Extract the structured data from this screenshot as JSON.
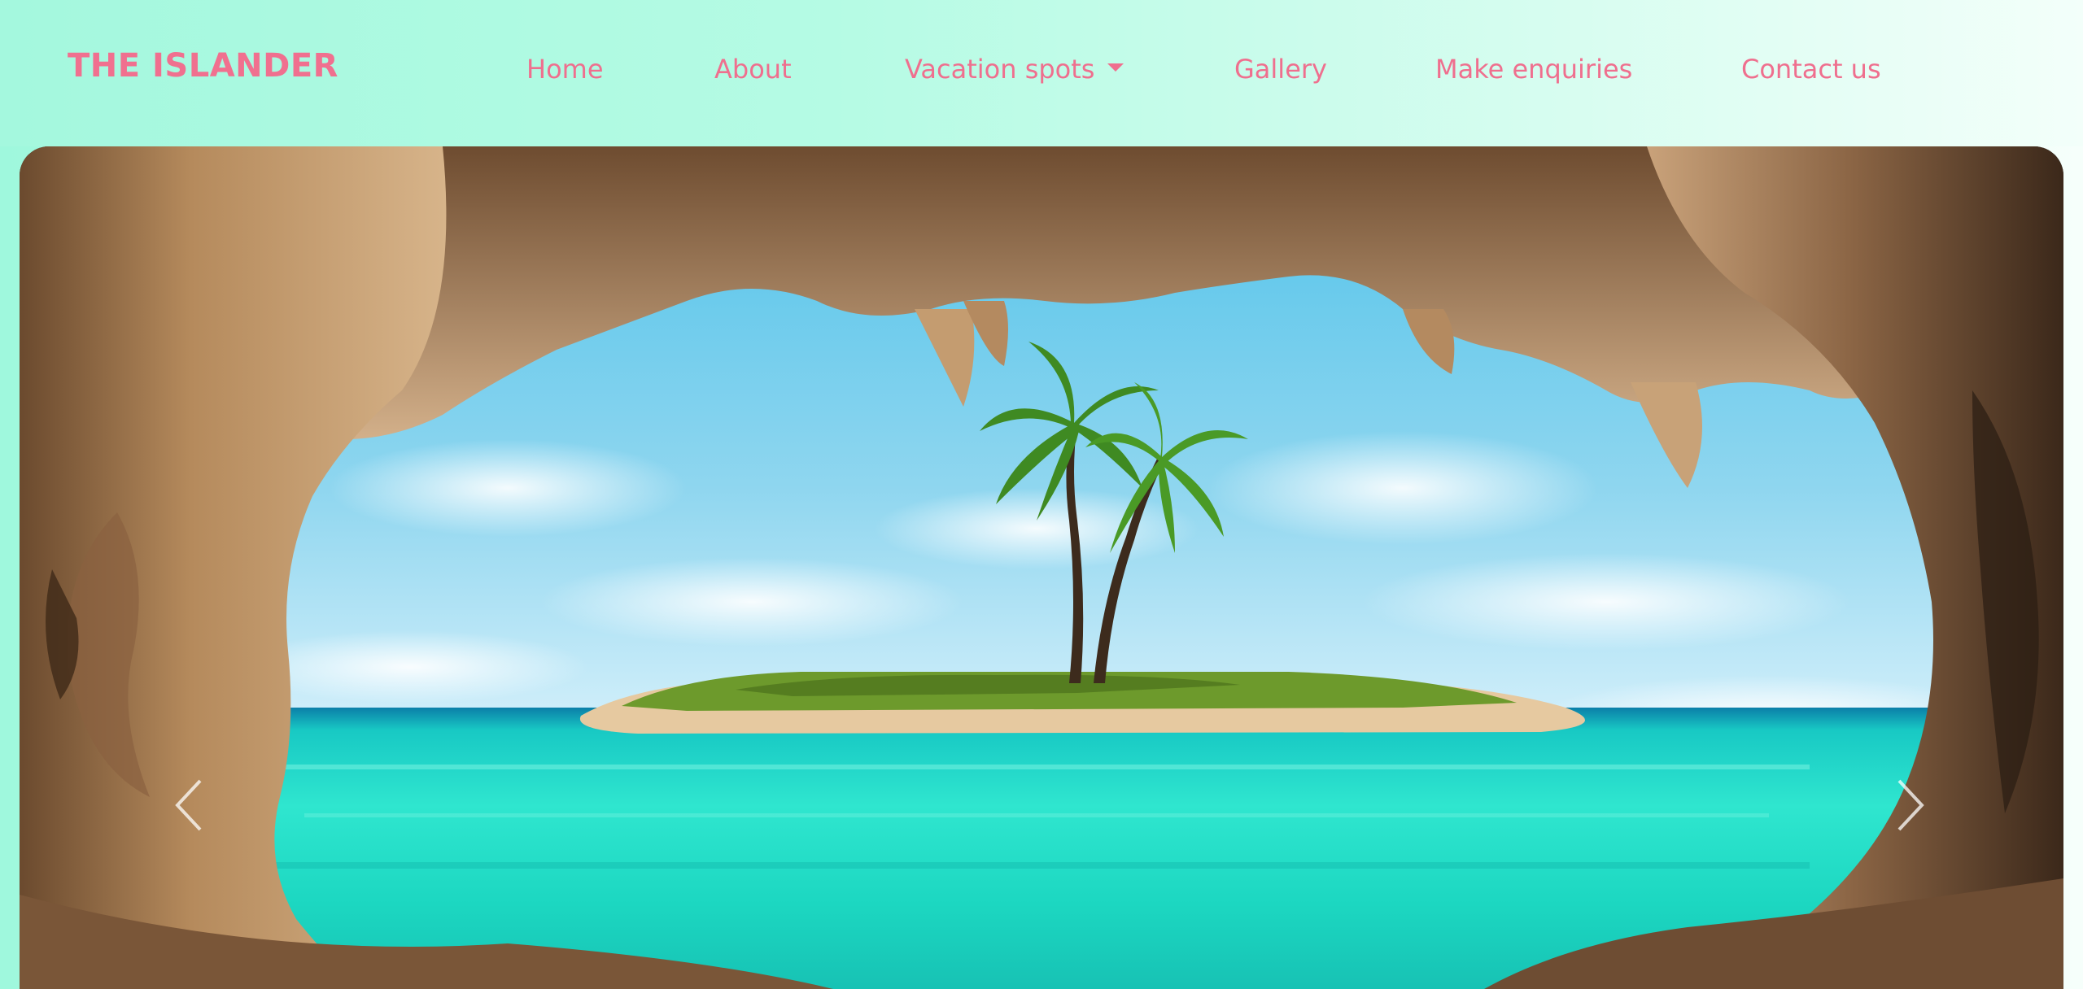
{
  "brand": {
    "name": "THE ISLANDER"
  },
  "nav": {
    "home": "Home",
    "about": "About",
    "vacation_spots": "Vacation spots",
    "gallery": "Gallery",
    "make_enquiries": "Make enquiries",
    "contact_us": "Contact us"
  },
  "carousel": {
    "prev_icon": "chevron-left-icon",
    "next_icon": "chevron-right-icon",
    "image_subject": "cave opening view of island with palm trees"
  },
  "colors": {
    "accent": "#ef6f8e",
    "nav_bg_start": "#a4f8de",
    "nav_bg_end": "#f3fffa"
  }
}
